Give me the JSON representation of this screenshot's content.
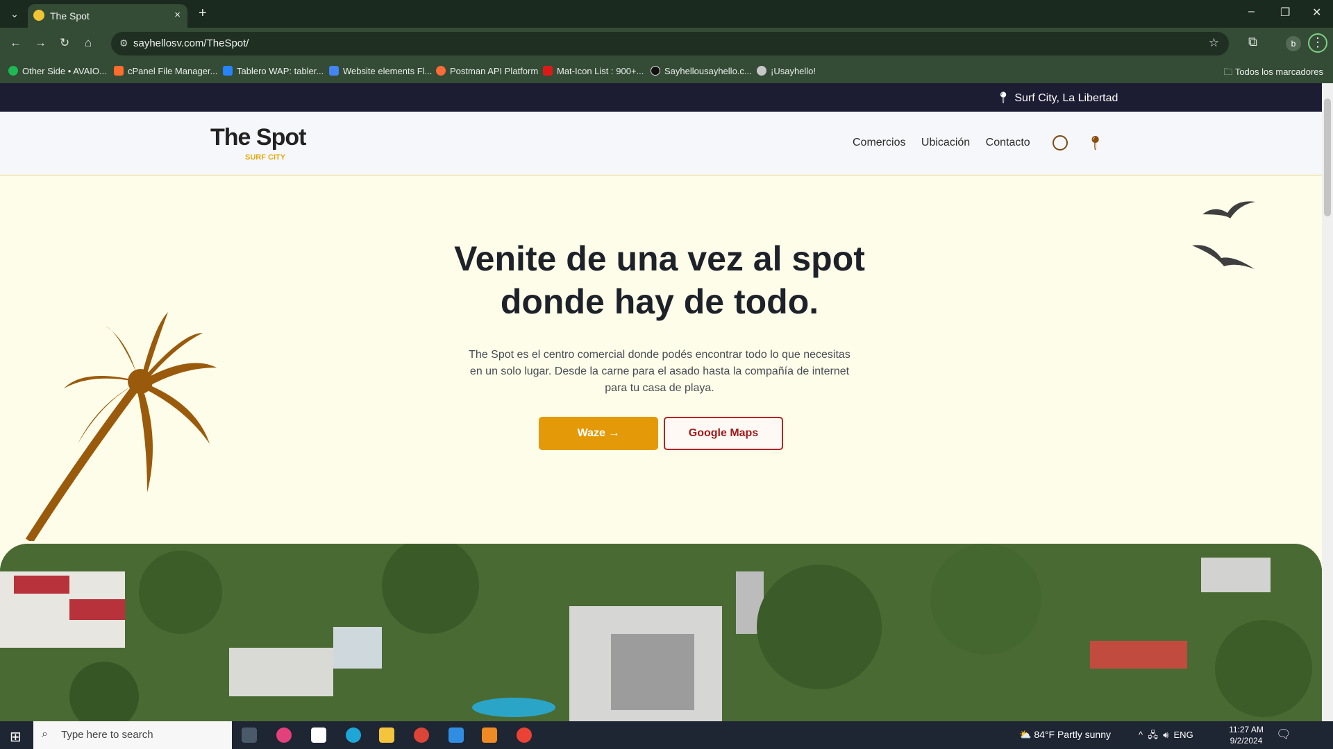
{
  "browser": {
    "tab_title": "The Spot",
    "tab_close": "×",
    "new_tab": "+",
    "url": "sayhellosv.com/TheSpot/",
    "profile_initial": "b",
    "window_controls": {
      "minimize": "–",
      "restore": "❐",
      "close": "✕"
    },
    "bookmarks": [
      {
        "label": "Other Side • AVAIO...",
        "color": "#1db954"
      },
      {
        "label": "cPanel File Manager...",
        "color": "#ff6c2c"
      },
      {
        "label": "Tablero WAP: tabler...",
        "color": "#2684ff"
      },
      {
        "label": "Website elements Fl...",
        "color": "#4285f4"
      },
      {
        "label": "Postman API Platform",
        "color": "#ff6c37"
      },
      {
        "label": "Mat-Icon List : 900+...",
        "color": "#dd1b16"
      },
      {
        "label": "Sayhellousayhello.c...",
        "color": "#111111"
      },
      {
        "label": "¡Usayhello!",
        "color": "#c7c7c7"
      }
    ],
    "all_bookmarks": "Todos los marcadores"
  },
  "site": {
    "location_label": "Surf City, La Libertad",
    "logo_text": "The Spot",
    "logo_sub": "SURF CITY",
    "nav": [
      "Comercios",
      "Ubicación",
      "Contacto"
    ],
    "hero_title_line1": "Venite de una vez al spot",
    "hero_title_line2": "donde hay de todo.",
    "hero_desc": "The Spot es el centro comercial donde podés encontrar todo lo que necesitas en un solo lugar. Desde la carne para el asado hasta la compañía de internet para tu casa de playa.",
    "btn_waze": "Waze →",
    "btn_maps": "Google Maps",
    "colors": {
      "accent": "#e49a08",
      "dark": "#1c1c33",
      "palm": "#9a5a0c",
      "maps_border": "#b72222"
    }
  },
  "taskbar": {
    "search_placeholder": "Type here to search",
    "weather": "84°F  Partly sunny",
    "language": "ENG",
    "time": "11:27 AM",
    "date": "9/2/2024"
  }
}
